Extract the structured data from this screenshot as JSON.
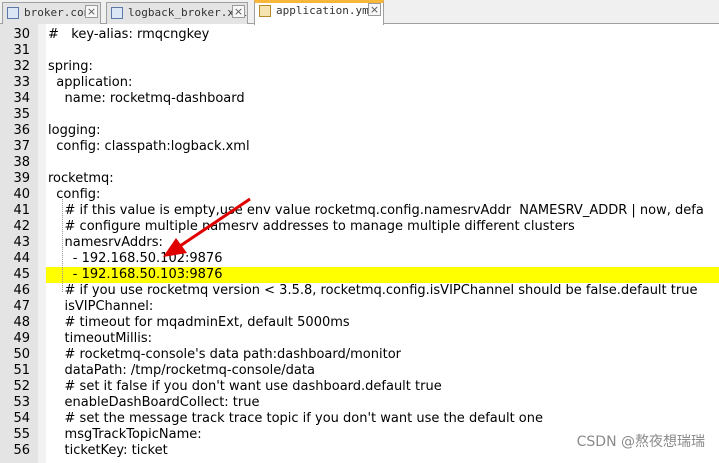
{
  "tabs": [
    {
      "name": "broker.conf",
      "active": false
    },
    {
      "name": "logback_broker.xml",
      "active": false
    },
    {
      "name": "application.yml",
      "active": true
    }
  ],
  "lines": [
    {
      "n": "30",
      "text": "#   key-alias: rmqcngkey"
    },
    {
      "n": "31",
      "text": ""
    },
    {
      "n": "32",
      "text": "spring:"
    },
    {
      "n": "33",
      "text": "  application:"
    },
    {
      "n": "34",
      "text": "    name: rocketmq-dashboard"
    },
    {
      "n": "35",
      "text": ""
    },
    {
      "n": "36",
      "text": "logging:"
    },
    {
      "n": "37",
      "text": "  config: classpath:logback.xml"
    },
    {
      "n": "38",
      "text": ""
    },
    {
      "n": "39",
      "text": "rocketmq:"
    },
    {
      "n": "40",
      "text": "  config:"
    },
    {
      "n": "41",
      "text": "    # if this value is empty,use env value rocketmq.config.namesrvAddr  NAMESRV_ADDR | now, defa"
    },
    {
      "n": "42",
      "text": "    # configure multiple namesrv addresses to manage multiple different clusters"
    },
    {
      "n": "43",
      "text": "    namesrvAddrs:"
    },
    {
      "n": "44",
      "text": "      - 192.168.50.102:9876"
    },
    {
      "n": "45",
      "text": "      - 192.168.50.103:9876",
      "highlight": true
    },
    {
      "n": "46",
      "text": "    # if you use rocketmq version < 3.5.8, rocketmq.config.isVIPChannel should be false.default true"
    },
    {
      "n": "47",
      "text": "    isVIPChannel:"
    },
    {
      "n": "48",
      "text": "    # timeout for mqadminExt, default 5000ms"
    },
    {
      "n": "49",
      "text": "    timeoutMillis:"
    },
    {
      "n": "50",
      "text": "    # rocketmq-console's data path:dashboard/monitor"
    },
    {
      "n": "51",
      "text": "    dataPath: /tmp/rocketmq-console/data"
    },
    {
      "n": "52",
      "text": "    # set it false if you don't want use dashboard.default true"
    },
    {
      "n": "53",
      "text": "    enableDashBoardCollect: true"
    },
    {
      "n": "54",
      "text": "    # set the message track trace topic if you don't want use the default one"
    },
    {
      "n": "55",
      "text": "    msgTrackTopicName:"
    },
    {
      "n": "56",
      "text": "    ticketKey: ticket"
    }
  ],
  "watermark": "CSDN @熬夜想瑞瑞",
  "colors": {
    "highlight": "#ffff00",
    "arrow": "#e00000",
    "active_tab_accent": "#f8b63a"
  },
  "icons": {
    "tab_file": "file-icon",
    "tab_close": "close-icon"
  }
}
